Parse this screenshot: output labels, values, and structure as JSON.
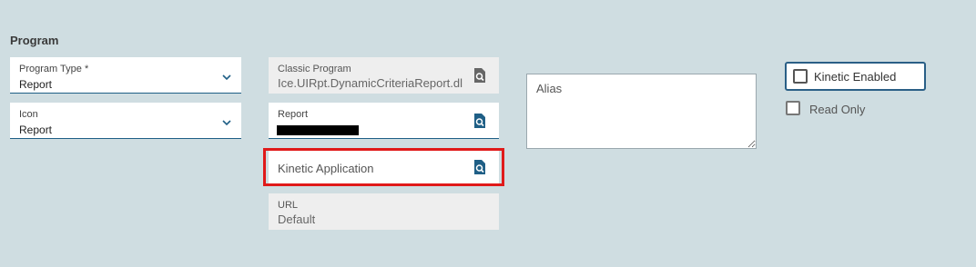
{
  "section": {
    "title": "Program"
  },
  "program_type": {
    "label": "Program Type *",
    "value": "Report"
  },
  "icon": {
    "label": "Icon",
    "value": "Report"
  },
  "classic_program": {
    "label": "Classic Program",
    "value": "Ice.UIRpt.DynamicCriteriaReport.dl"
  },
  "report": {
    "label": "Report"
  },
  "kinetic_application": {
    "label": "Kinetic Application"
  },
  "url": {
    "label": "URL",
    "value": "Default"
  },
  "alias": {
    "placeholder": "Alias"
  },
  "kinetic_enabled": {
    "label": "Kinetic Enabled",
    "checked": false
  },
  "read_only": {
    "label": "Read Only",
    "checked": false
  },
  "colors": {
    "accent": "#1f5f86",
    "highlight": "#e01a1a",
    "background": "#cfdde1"
  }
}
